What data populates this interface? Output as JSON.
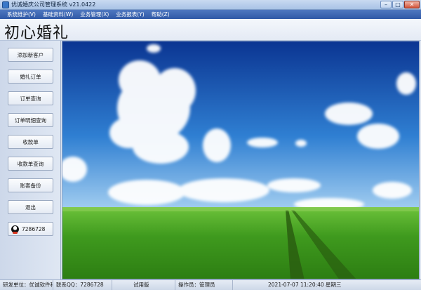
{
  "window": {
    "title": "优诚婚庆公司管理系统  v21.0422",
    "minimize_glyph": "–",
    "maximize_glyph": "□",
    "close_glyph": "✕"
  },
  "menu": {
    "items": [
      "系统维护(V)",
      "基础资料(W)",
      "业务管理(X)",
      "业务报表(Y)",
      "帮助(Z)"
    ]
  },
  "banner": {
    "brand": "初心婚礼"
  },
  "sidebar": {
    "buttons": [
      "添加新客户",
      "婚礼订单",
      "订单查询",
      "订单明细查询",
      "收款单",
      "收款单查询",
      "账套备份",
      "退出"
    ],
    "qq_number": "7286728",
    "qq_icon": "qq-penguin-icon"
  },
  "status": {
    "developer": "研发单位：优诚软件科技",
    "contact": "联系QQ：7286728",
    "edition": "试用版",
    "operator": "操作员：管理员",
    "datetime": "2021-07-07 11:20:40 星期三"
  },
  "colors": {
    "menubar": "#3a64b2",
    "sky_top": "#0d3c9c",
    "grass": "#3d9a1c"
  }
}
